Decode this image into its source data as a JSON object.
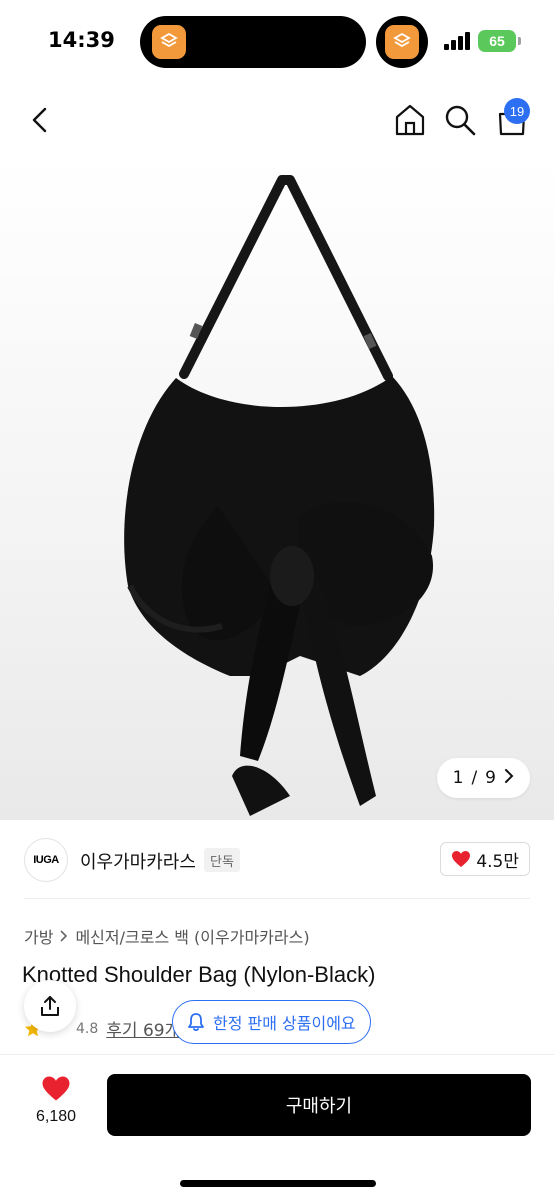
{
  "status_bar": {
    "time": "14:39",
    "battery": "65",
    "colors": {
      "battery": "#5ac85a",
      "app_icon": "#f29a3b"
    },
    "icons": [
      "app-shortcut-icon",
      "signal-icon",
      "battery-icon"
    ]
  },
  "nav": {
    "icons": [
      "back-icon",
      "home-icon",
      "search-icon",
      "cart-icon"
    ],
    "cart_count": "19"
  },
  "gallery": {
    "current": "1",
    "total": "9",
    "separator": "/"
  },
  "brand": {
    "logo_text": "IUGA",
    "name": "이우가마카라스",
    "tag": "단독",
    "like_count": "4.5만"
  },
  "product": {
    "category": [
      "가방",
      "메신저/크로스 백 (이우가마카라스)"
    ],
    "title": "Knotted Shoulder Bag (Nylon-Black)",
    "rating": "4.8",
    "reviews": "후기 69개",
    "limited_badge": "한정 판매 상품이에요"
  },
  "bottom_bar": {
    "wish_count": "6,180",
    "buy_label": "구매하기"
  },
  "colors": {
    "accent": "#2d6ff2",
    "heart": "#e8232f",
    "star": "#f5b800",
    "buy_button": "#000000"
  }
}
